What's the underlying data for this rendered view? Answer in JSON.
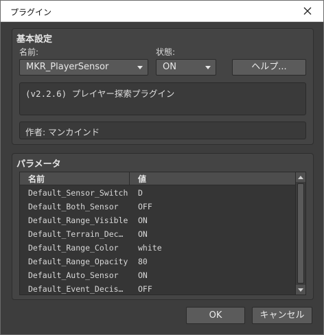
{
  "window": {
    "title": "プラグイン"
  },
  "basic": {
    "heading": "基本設定",
    "name_label": "名前:",
    "name_value": "MKR_PlayerSensor",
    "state_label": "状態:",
    "state_value": "ON",
    "help_button": "ヘルプ...",
    "description": "(v2.2.6) プレイヤー探索プラグイン",
    "author": "作者: マンカインド"
  },
  "params": {
    "heading": "パラメータ",
    "col_name": "名前",
    "col_value": "値",
    "rows": [
      {
        "name": "Default_Sensor_Switch",
        "value": "D"
      },
      {
        "name": "Default_Both_Sensor",
        "value": "OFF"
      },
      {
        "name": "Default_Range_Visible",
        "value": "ON"
      },
      {
        "name": "Default_Terrain_Dec…",
        "value": "ON"
      },
      {
        "name": "Default_Range_Color",
        "value": "white"
      },
      {
        "name": "Default_Range_Opacity",
        "value": "80"
      },
      {
        "name": "Default_Auto_Sensor",
        "value": "ON"
      },
      {
        "name": "Default_Event_Decis…",
        "value": "OFF"
      }
    ]
  },
  "footer": {
    "ok": "OK",
    "cancel": "キャンセル"
  },
  "colors": {
    "window_bg": "#3d3d3d",
    "panel_bg": "#444444",
    "field_bg": "#585858",
    "text": "#e6e6e6"
  }
}
